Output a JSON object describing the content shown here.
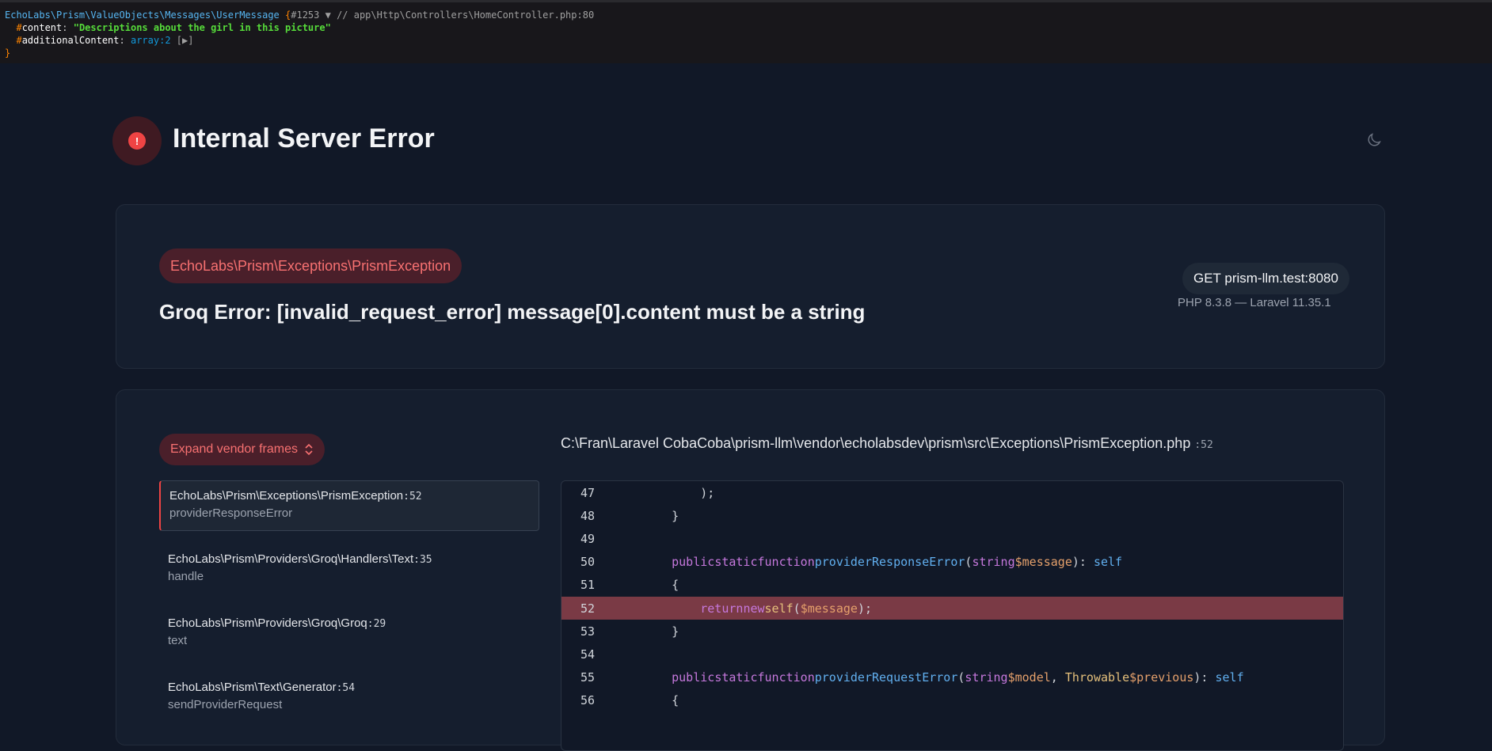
{
  "dump": {
    "class_name": "EchoLabs\\Prism\\ValueObjects\\Messages\\UserMessage",
    "open_brace": "{",
    "ref": "#1253 ▼",
    "comment": "// app\\Http\\Controllers\\HomeController.php:80",
    "content_key": "content",
    "content_value": "\"Descriptions about the girl in this picture\"",
    "additional_key": "additionalContent",
    "additional_value": "array:2",
    "additional_toggle": "[▶]",
    "close_brace": "}"
  },
  "header": {
    "title": "Internal Server Error",
    "theme_toggle_icon": "moon-icon",
    "error_icon": "exclamation-icon",
    "error_icon_glyph": "!"
  },
  "exception": {
    "class": "EchoLabs\\Prism\\Exceptions\\PrismException",
    "message": "Groq Error: [invalid_request_error] message[0].content must be a string",
    "request": "GET prism-llm.test:8080",
    "versions": "PHP 8.3.8 — Laravel 11.35.1"
  },
  "trace": {
    "expand_label": "Expand vendor frames",
    "frames": [
      {
        "class": "EchoLabs\\Prism\\Exceptions\\PrismException",
        "line": ":52",
        "function": "providerResponseError"
      },
      {
        "class": "EchoLabs\\Prism\\Providers\\Groq\\Handlers\\Text",
        "line": ":35",
        "function": "handle"
      },
      {
        "class": "EchoLabs\\Prism\\Providers\\Groq\\Groq",
        "line": ":29",
        "function": "text"
      },
      {
        "class": "EchoLabs\\Prism\\Text\\Generator",
        "line": ":54",
        "function": "sendProviderRequest"
      }
    ],
    "file_path": "C:\\Fran\\Laravel CobaCoba\\prism-llm\\vendor\\echolabsdev\\prism\\src\\Exceptions\\PrismException.php",
    "file_line": ":52",
    "code_lines": [
      {
        "num": "47"
      },
      {
        "num": "48"
      },
      {
        "num": "49"
      },
      {
        "num": "50"
      },
      {
        "num": "51"
      },
      {
        "num": "52"
      },
      {
        "num": "53"
      },
      {
        "num": "54"
      },
      {
        "num": "55"
      },
      {
        "num": "56"
      }
    ],
    "code_text": {
      "l47": "        );",
      "l48": "    }",
      "l50_kw1": "public",
      "l50_kw2": "static",
      "l50_kw3": "function",
      "l50_fn": "providerResponseError",
      "l50_p1": "(",
      "l50_type": "string",
      "l50_var": "$message",
      "l50_p2": "): ",
      "l50_ret": "self",
      "l51": "    {",
      "l52_kw1": "return",
      "l52_kw2": "new",
      "l52_self": "self",
      "l52_p1": "(",
      "l52_var": "$message",
      "l52_p2": ");",
      "l53": "    }",
      "l55_kw1": "public",
      "l55_kw2": "static",
      "l55_kw3": "function",
      "l55_fn": "providerRequestError",
      "l55_p1": "(",
      "l55_type1": "string",
      "l55_var1": "$model",
      "l55_comma": ", ",
      "l55_type2": "Throwable",
      "l55_var2": "$previous",
      "l55_p2": "): ",
      "l55_ret": "self",
      "l56": "    {"
    }
  }
}
